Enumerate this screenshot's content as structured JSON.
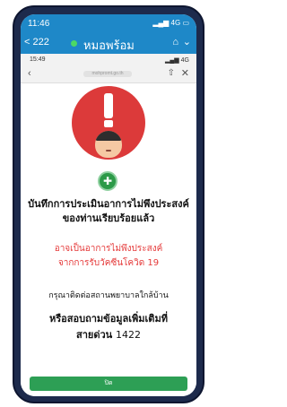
{
  "status_bar": {
    "time": "11:46",
    "signal": "4G"
  },
  "app_bar": {
    "back_label": "< 222",
    "title": "หมอพร้อม"
  },
  "inner_status": {
    "time": "15:49",
    "signal": "4G"
  },
  "url_bar": {
    "url": "mohpromt.go.th"
  },
  "content": {
    "heading_line1": "บันทึกการประเมินอาการไม่พึงประสงค์",
    "heading_line2": "ของท่านเรียบร้อยแล้ว",
    "warning_line1": "อาจเป็นอาการไม่พึงประสงค์",
    "warning_line2": "จากการรับวัคซีนโควิด 19",
    "contact_text": "กรุณาติดต่อสถานพยาบาลใกล้บ้าน",
    "hotline_line1": "หรือสอบถามข้อมูลเพิ่มเติมที่",
    "hotline_prefix": "สายด่วน",
    "hotline_number": "1422",
    "close_button": "ปิด"
  },
  "colors": {
    "accent": "#1e88c8",
    "alert_red": "#dc3a3a",
    "button_green": "#2d9f55",
    "warning_text": "#e53a3a"
  }
}
